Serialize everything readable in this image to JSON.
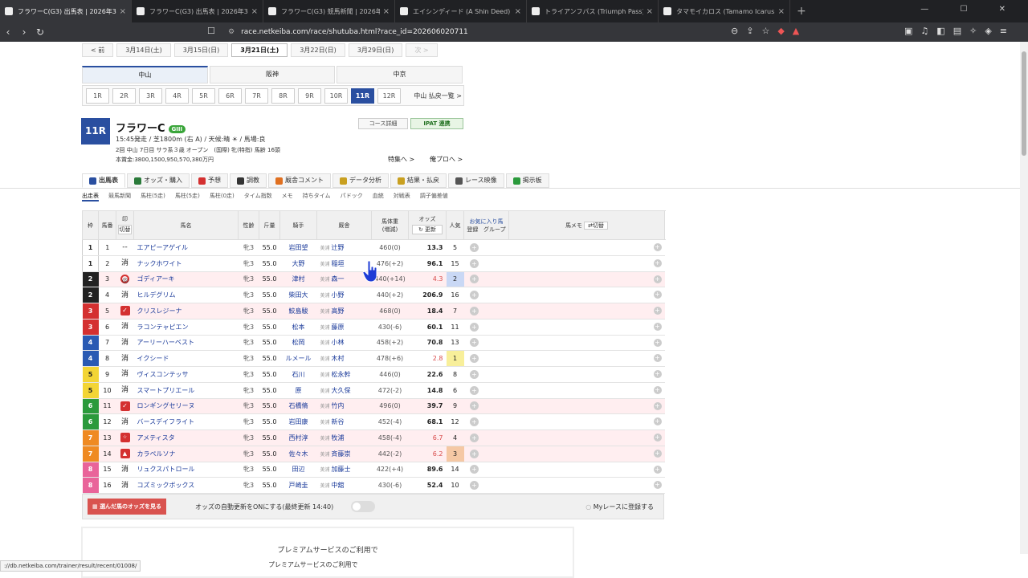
{
  "browser": {
    "tabs": [
      {
        "title": "フラワーC(G3) 出馬表 | 2026年3月2…",
        "active": true
      },
      {
        "title": "フラワーC(G3) 出馬表 | 2026年3月21日…"
      },
      {
        "title": "フラワーC(G3) 競馬新聞 | 2026年3月2…"
      },
      {
        "title": "エイシンディード (A Shin Deed) | 競走馬…"
      },
      {
        "title": "トライアンフパス (Triumph Pass) | 競走馬…"
      },
      {
        "title": "タマモイカロス (Tamamo Icarus) | 競走馬…"
      }
    ],
    "url": "race.netkeiba.com/race/shutuba.html?race_id=202606020711"
  },
  "date_nav": {
    "prev": "< 前",
    "dates": [
      "3月14日(土)",
      "3月15日(日)",
      "3月21日(土)",
      "3月22日(日)",
      "3月29日(日)"
    ],
    "active_index": 2,
    "next": "次 >"
  },
  "venues": [
    "中山",
    "阪神",
    "中京"
  ],
  "races": [
    "1R",
    "2R",
    "3R",
    "4R",
    "5R",
    "6R",
    "7R",
    "8R",
    "9R",
    "10R",
    "11R",
    "12R"
  ],
  "race_list_link": "中山 払戻一覧 >",
  "race": {
    "num": "11R",
    "name": "フラワーC",
    "grade": "GIII",
    "info1": "15:45発走 / 芝1800m (右 A) / 天候:晴 ☀ / 馬場:良",
    "info2": "2回 中山 7日目 サラ系３歳 オープン　(国際) 牝(特指) 馬齢 16頭",
    "info3": "本賞金:3800,1500,950,570,380万円",
    "course_btn": "コース詳細",
    "ipat_btn": "IPAT 連携",
    "tokusyu": "特集へ >",
    "oreno": "俺プロへ >"
  },
  "main_tabs": [
    "出馬表",
    "オッズ・購入",
    "予想",
    "調教",
    "厩舎コメント",
    "データ分析",
    "結果・払戻",
    "レース映像",
    "掲示板"
  ],
  "sub_tabs": [
    "出走表",
    "競馬新聞",
    "馬柱(5走)",
    "馬柱(5走)",
    "馬柱(0走)",
    "タイム指数",
    "メモ",
    "持ちタイム",
    "パドック",
    "血統",
    "対戦表",
    "調子偏差値"
  ],
  "table": {
    "headers": {
      "waku": "枠",
      "umaban": "馬番",
      "mark": "印",
      "mark_sub": "切替",
      "name": "馬名",
      "age": "性齢",
      "kinryo": "斤量",
      "jockey": "騎手",
      "trainer": "厩舎",
      "weight": "馬体重",
      "weight_sub": "(増減)",
      "odds": "オッズ",
      "odds_sub": "更新",
      "ninki": "人気",
      "fav": "お気に入り馬",
      "fav_reg": "登録",
      "fav_group": "グループ",
      "memo": "馬メモ",
      "memo_sub": "切替"
    },
    "rows": [
      {
        "waku": "1",
        "num": "1",
        "mark": "--",
        "name": "エアピーアゲイル",
        "age": "牝3",
        "kin": "55.0",
        "jockey": "岩田望",
        "reg": "美浦",
        "trainer": "辻野",
        "weight": "460(0)",
        "odds": "13.3",
        "ninki": "5"
      },
      {
        "waku": "1",
        "num": "2",
        "mark": "消",
        "name": "ナックホワイト",
        "age": "牝3",
        "kin": "55.0",
        "jockey": "大野",
        "reg": "美浦",
        "trainer": "稲垣",
        "weight": "476(+2)",
        "odds": "96.1",
        "ninki": "15"
      },
      {
        "waku": "2",
        "num": "3",
        "mark": "◎",
        "name": "ゴディアーキ",
        "age": "牝3",
        "kin": "55.0",
        "jockey": "津村",
        "reg": "美浦",
        "trainer": "森一",
        "weight": "440(+14)",
        "odds": "4.3",
        "ninki": "2",
        "pink": true
      },
      {
        "waku": "2",
        "num": "4",
        "mark": "消",
        "name": "ヒルデグリム",
        "age": "牝3",
        "kin": "55.0",
        "jockey": "柴田大",
        "reg": "美浦",
        "trainer": "小野",
        "weight": "440(+2)",
        "odds": "206.9",
        "ninki": "16"
      },
      {
        "waku": "3",
        "num": "5",
        "mark": "✓",
        "name": "クリスレジーナ",
        "age": "牝3",
        "kin": "55.0",
        "jockey": "鮫島駿",
        "reg": "美浦",
        "trainer": "高野",
        "weight": "468(0)",
        "odds": "18.4",
        "ninki": "7",
        "pink": true
      },
      {
        "waku": "3",
        "num": "6",
        "mark": "消",
        "name": "ラコンテャピエン",
        "age": "牝3",
        "kin": "55.0",
        "jockey": "松本",
        "reg": "美浦",
        "trainer": "藤原",
        "weight": "430(-6)",
        "odds": "60.1",
        "ninki": "11"
      },
      {
        "waku": "4",
        "num": "7",
        "mark": "消",
        "name": "アーリーハーベスト",
        "age": "牝3",
        "kin": "55.0",
        "jockey": "松岡",
        "reg": "美浦",
        "trainer": "小林",
        "weight": "458(+2)",
        "odds": "70.8",
        "ninki": "13"
      },
      {
        "waku": "4",
        "num": "8",
        "mark": "消",
        "name": "イクシード",
        "age": "牝3",
        "kin": "55.0",
        "jockey": "ルメール",
        "reg": "美浦",
        "trainer": "木村",
        "weight": "478(+6)",
        "odds": "2.8",
        "ninki": "1"
      },
      {
        "waku": "5",
        "num": "9",
        "mark": "消",
        "name": "ヴィスコンテッサ",
        "age": "牝3",
        "kin": "55.0",
        "jockey": "石川",
        "reg": "美浦",
        "trainer": "松永幹",
        "weight": "446(0)",
        "odds": "22.6",
        "ninki": "8"
      },
      {
        "waku": "5",
        "num": "10",
        "mark": "消",
        "name": "スマートプリエール",
        "age": "牝3",
        "kin": "55.0",
        "jockey": "原",
        "reg": "美浦",
        "trainer": "大久保",
        "weight": "472(-2)",
        "odds": "14.8",
        "ninki": "6"
      },
      {
        "waku": "6",
        "num": "11",
        "mark": "✓",
        "name": "ロンギングセリーヌ",
        "age": "牝3",
        "kin": "55.0",
        "jockey": "石橋脩",
        "reg": "美浦",
        "trainer": "竹内",
        "weight": "496(0)",
        "odds": "39.7",
        "ninki": "9",
        "pink": true
      },
      {
        "waku": "6",
        "num": "12",
        "mark": "消",
        "name": "バースデイフライト",
        "age": "牝3",
        "kin": "55.0",
        "jockey": "岩田康",
        "reg": "美浦",
        "trainer": "新谷",
        "weight": "452(-4)",
        "odds": "68.1",
        "ninki": "12"
      },
      {
        "waku": "7",
        "num": "13",
        "mark": "☆",
        "name": "アメティスタ",
        "age": "牝3",
        "kin": "55.0",
        "jockey": "西村淳",
        "reg": "美浦",
        "trainer": "牧浦",
        "weight": "458(-4)",
        "odds": "6.7",
        "ninki": "4",
        "pink": true
      },
      {
        "waku": "7",
        "num": "14",
        "mark": "▲",
        "name": "カラペルソナ",
        "age": "牝3",
        "kin": "55.0",
        "jockey": "佐々木",
        "reg": "美浦",
        "trainer": "斉藤崇",
        "weight": "442(-2)",
        "odds": "6.2",
        "ninki": "3",
        "pink": true
      },
      {
        "waku": "8",
        "num": "15",
        "mark": "消",
        "name": "リュクスパトロール",
        "age": "牝3",
        "kin": "55.0",
        "jockey": "田辺",
        "reg": "美浦",
        "trainer": "加藤士",
        "weight": "422(+4)",
        "odds": "89.6",
        "ninki": "14"
      },
      {
        "waku": "8",
        "num": "16",
        "mark": "消",
        "name": "コズミックボックス",
        "age": "牝3",
        "kin": "55.0",
        "jockey": "戸崎圭",
        "reg": "美浦",
        "trainer": "中舘",
        "weight": "430(-6)",
        "odds": "52.4",
        "ninki": "10"
      }
    ]
  },
  "bottom": {
    "selected_odds": "選んだ馬のオッズを見る",
    "auto_update": "オッズの自動更新をONにする(最終更新 14:40)",
    "my_race": "Myレースに登録する"
  },
  "premium_text": "プレミアムサービスのご利用で",
  "footer_text": "プレミアムサービスのご利用で",
  "status_url": "://db.netkeiba.com/trainer/result/recent/01008/"
}
